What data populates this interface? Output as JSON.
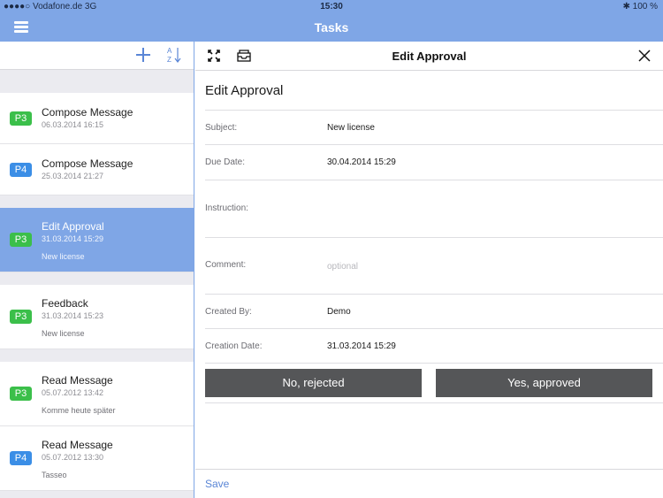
{
  "status_bar": {
    "carrier": "●●●●○ Vodafone.de   3G",
    "time": "15:30",
    "battery": "✱  100 %"
  },
  "nav": {
    "title": "Tasks"
  },
  "task_list": {
    "items": [
      {
        "priority": "P3",
        "title": "Compose Message",
        "date": "06.03.2014 16:15",
        "note": ""
      },
      {
        "priority": "P4",
        "title": "Compose Message",
        "date": "25.03.2014 21:27",
        "note": ""
      },
      {
        "priority": "P3",
        "title": "Edit Approval",
        "date": "31.03.2014 15:29",
        "note": "New license"
      },
      {
        "priority": "P3",
        "title": "Feedback",
        "date": "31.03.2014 15:23",
        "note": "New license"
      },
      {
        "priority": "P3",
        "title": "Read Message",
        "date": "05.07.2012 13:42",
        "note": "Komme heute später"
      },
      {
        "priority": "P4",
        "title": "Read Message",
        "date": "05.07.2012 13:30",
        "note": "Tasseo"
      }
    ]
  },
  "detail": {
    "toolbar_title": "Edit Approval",
    "form_title": "Edit Approval",
    "subject_label": "Subject:",
    "subject_value": "New license",
    "due_label": "Due Date:",
    "due_value": "30.04.2014 15:29",
    "instruction_label": "Instruction:",
    "comment_label": "Comment:",
    "comment_placeholder": "optional",
    "created_by_label": "Created By:",
    "created_by_value": "Demo",
    "creation_date_label": "Creation Date:",
    "creation_date_value": "31.03.2014 15:29",
    "reject_label": "No, rejected",
    "approve_label": "Yes, approved",
    "save_label": "Save"
  },
  "colors": {
    "accent": "#7fa6e6",
    "priority_p3": "#3bbf4a",
    "priority_p4": "#3b8ee6",
    "button_dark": "#555658"
  },
  "icons": [
    "menu-icon",
    "add-icon",
    "sort-az-icon",
    "expand-icon",
    "archive-icon",
    "close-icon"
  ]
}
